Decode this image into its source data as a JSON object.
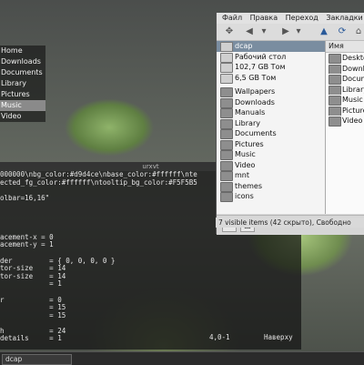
{
  "bookmarks": [
    "Home",
    "Downloads",
    "Documents",
    "Library",
    "Pictures",
    "Music",
    "Video"
  ],
  "bookmarks_selected": "Music",
  "terminal": {
    "title": "urxvt",
    "lines": [
      "000000\\nbg_color:#d9d4ce\\nbase_color:#ffffff\\nte",
      "ected_fg_color:#ffffff\\ntooltip_bg_color:#F5F5B5",
      "",
      "olbar=16,16\"",
      "",
      "",
      "",
      "",
      "acement-x = 0",
      "acement-y = 1",
      "",
      "der         = { 0, 0, 0, 0 }",
      "tor-size    = 14",
      "tor-size    = 14",
      "            = 1",
      "",
      "r           = 0",
      "            = 15",
      "            = 15",
      "",
      "h           = 24",
      "details     = 1"
    ],
    "status_pos": "4,0-1",
    "status_where": "Наверху"
  },
  "file_manager": {
    "menu": [
      "Файл",
      "Правка",
      "Переход",
      "Закладки"
    ],
    "path_label": "dcap",
    "places": [
      {
        "label": "dcap",
        "icon": "home-folder-icon",
        "selected": true
      },
      {
        "label": "Рабочий стол",
        "icon": "desktop-icon",
        "selected": false
      },
      {
        "label": "102,7 GB Том",
        "icon": "drive-icon",
        "selected": false
      },
      {
        "label": "6,5 GB Том",
        "icon": "drive-icon",
        "selected": false
      }
    ],
    "bookmarks": [
      "Wallpapers",
      "Downloads",
      "Manuals",
      "Library",
      "Documents",
      "Pictures",
      "Music",
      "Video",
      "mnt",
      "themes",
      "icons"
    ],
    "list_header": "Имя",
    "list_items": [
      "Desktop",
      "Downloads",
      "Documents",
      "Library",
      "Music",
      "Pictures",
      "Video"
    ],
    "status": "7 visible items (42 скрыто), Свободно"
  },
  "taskbar": {
    "task_label": "dcap"
  }
}
